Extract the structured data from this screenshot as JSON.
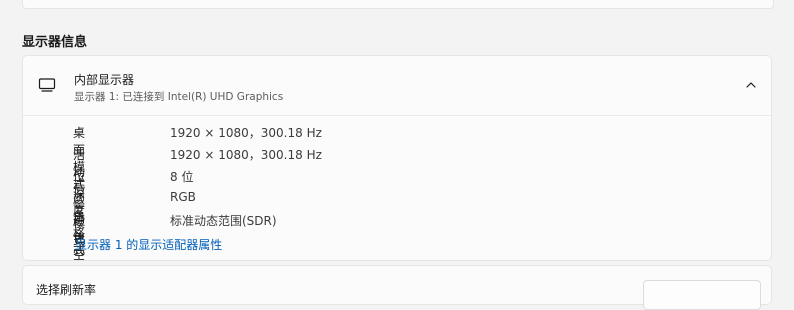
{
  "section": {
    "title": "显示器信息"
  },
  "display": {
    "name": "内部显示器",
    "connection": "显示器 1: 已连接到 Intel(R) UHD Graphics",
    "icon": "monitor-icon",
    "expanded": true,
    "details": [
      {
        "label": "桌面模式",
        "value": "1920 × 1080，300.18 Hz"
      },
      {
        "label": "活动信号模式",
        "value": "1920 × 1080，300.18 Hz"
      },
      {
        "label": "位深度",
        "value": "8 位"
      },
      {
        "label": "颜色格式",
        "value": "RGB"
      },
      {
        "label": "颜色空间",
        "value": "标准动态范围(SDR)"
      }
    ],
    "adapter_link": "显示器 1 的显示适配器属性"
  },
  "refresh": {
    "label": "选择刷新率"
  },
  "colors": {
    "accent": "#005fb8",
    "background": "#f3f3f3",
    "card": "#fbfbfb"
  }
}
